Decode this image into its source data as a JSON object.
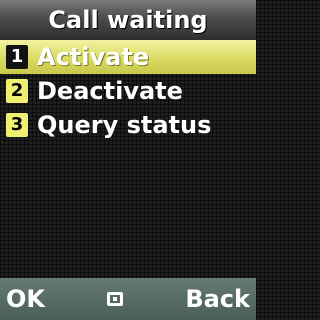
{
  "header": {
    "title": "Call waiting"
  },
  "menu": {
    "items": [
      {
        "number": "1",
        "label": "Activate",
        "selected": true
      },
      {
        "number": "2",
        "label": "Deactivate",
        "selected": false
      },
      {
        "number": "3",
        "label": "Query status",
        "selected": false
      }
    ]
  },
  "softkeys": {
    "left": "OK",
    "center_icon": "menu-square-icon",
    "right": "Back"
  },
  "colors": {
    "highlight": "#d8d860",
    "number_box": "#f0f070",
    "softkey_bar": "#566b64"
  }
}
